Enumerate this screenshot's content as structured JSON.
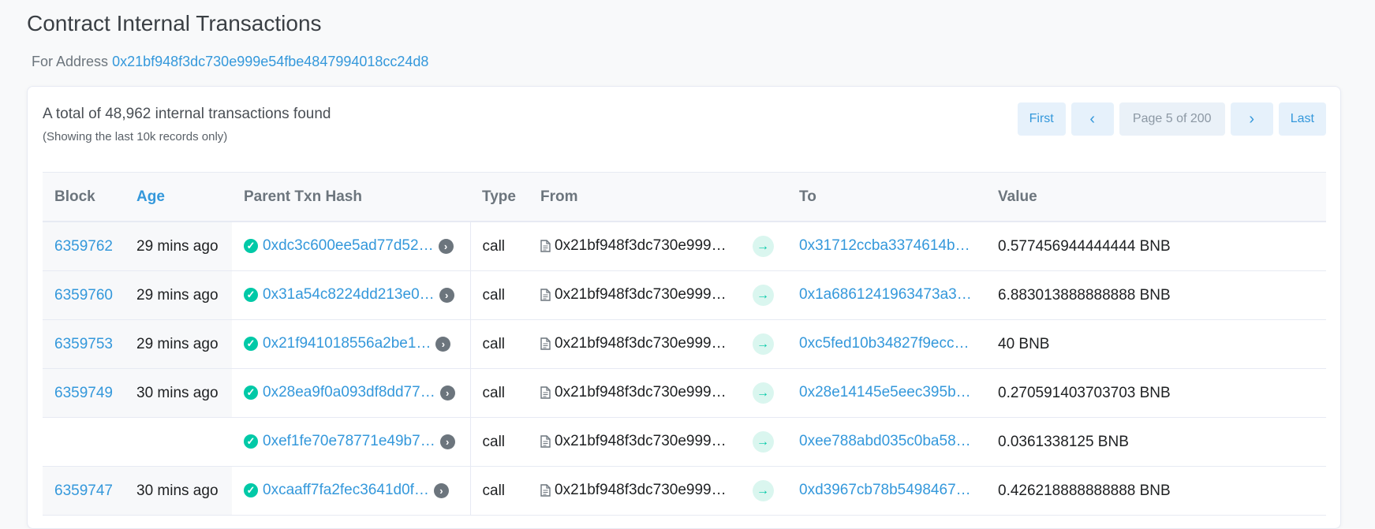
{
  "page": {
    "title": "Contract Internal Transactions",
    "for_label": "For Address",
    "address": "0x21bf948f3dc730e999e54fbe4847994018cc24d8"
  },
  "summary": {
    "total": "A total of 48,962 internal transactions found",
    "note": "(Showing the last 10k records only)"
  },
  "pager": {
    "first": "First",
    "prev": "‹",
    "info": "Page 5 of 200",
    "next": "›",
    "last": "Last"
  },
  "columns": {
    "block": "Block",
    "age": "Age",
    "parent": "Parent Txn Hash",
    "type": "Type",
    "from": "From",
    "to": "To",
    "value": "Value"
  },
  "rows": [
    {
      "block": "6359762",
      "age": "29 mins ago",
      "parent": "0xdc3c600ee5ad77d52…",
      "type": "call",
      "from": "0x21bf948f3dc730e999…",
      "to": "0x31712ccba3374614b…",
      "value": "0.577456944444444 BNB"
    },
    {
      "block": "6359760",
      "age": "29 mins ago",
      "parent": "0x31a54c8224dd213e0…",
      "type": "call",
      "from": "0x21bf948f3dc730e999…",
      "to": "0x1a6861241963473a3…",
      "value": "6.883013888888888 BNB"
    },
    {
      "block": "6359753",
      "age": "29 mins ago",
      "parent": "0x21f941018556a2be1…",
      "type": "call",
      "from": "0x21bf948f3dc730e999…",
      "to": "0xc5fed10b34827f9ecc…",
      "value": "40 BNB"
    },
    {
      "block": "6359749",
      "age": "30 mins ago",
      "parent": "0x28ea9f0a093df8dd77…",
      "type": "call",
      "from": "0x21bf948f3dc730e999…",
      "to": "0x28e14145e5eec395b…",
      "value": "0.270591403703703 BNB"
    },
    {
      "block": "",
      "age": "",
      "parent": "0xef1fe70e78771e49b7…",
      "type": "call",
      "from": "0x21bf948f3dc730e999…",
      "to": "0xee788abd035c0ba58…",
      "value": "0.0361338125 BNB"
    },
    {
      "block": "6359747",
      "age": "30 mins ago",
      "parent": "0xcaaff7fa2fec3641d0f…",
      "type": "call",
      "from": "0x21bf948f3dc730e999…",
      "to": "0xd3967cb78b5498467…",
      "value": "0.426218888888888 BNB"
    }
  ],
  "icons": {
    "success": "check-circle-icon",
    "detail": "chevron-right-circle-icon",
    "contract": "document-icon",
    "transfer": "arrow-right-icon"
  },
  "colors": {
    "link": "#3498db",
    "success": "#00c9a7"
  }
}
